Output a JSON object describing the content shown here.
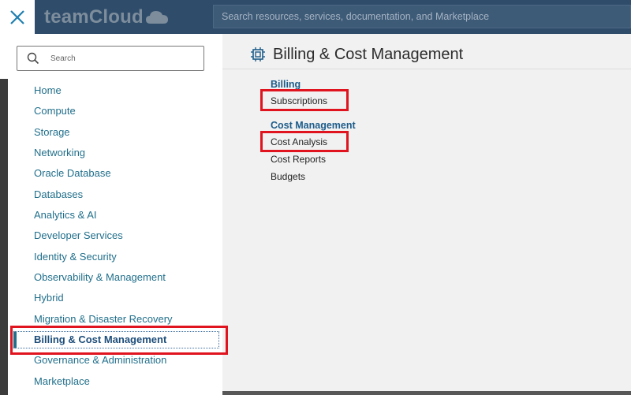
{
  "header": {
    "brand_name": "teamCloud",
    "search_placeholder": "Search resources, services, documentation, and Marketplace",
    "brand_color": "#2f4d6b"
  },
  "sidebar": {
    "search_placeholder": "Search",
    "items": [
      {
        "label": "Home"
      },
      {
        "label": "Compute"
      },
      {
        "label": "Storage"
      },
      {
        "label": "Networking"
      },
      {
        "label": "Oracle Database"
      },
      {
        "label": "Databases"
      },
      {
        "label": "Analytics & AI"
      },
      {
        "label": "Developer Services"
      },
      {
        "label": "Identity & Security"
      },
      {
        "label": "Observability & Management"
      },
      {
        "label": "Hybrid"
      },
      {
        "label": "Migration & Disaster Recovery"
      },
      {
        "label": "Billing & Cost Management",
        "active": true
      },
      {
        "label": "Governance & Administration"
      },
      {
        "label": "Marketplace"
      }
    ]
  },
  "main": {
    "title": "Billing & Cost Management",
    "icon": "chip-icon",
    "sections": [
      {
        "heading": "Billing",
        "links": [
          "Subscriptions"
        ]
      },
      {
        "heading": "Cost Management",
        "links": [
          "Cost Analysis",
          "Cost Reports",
          "Budgets"
        ]
      }
    ]
  },
  "colors": {
    "link": "#216f8b",
    "section_heading": "#1d5c8a",
    "highlight": "#e0141e"
  }
}
